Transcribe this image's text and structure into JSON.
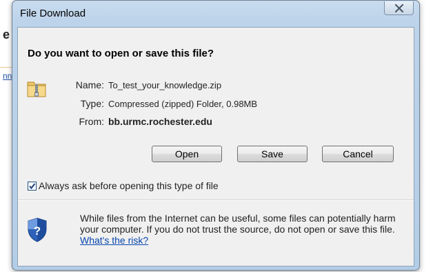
{
  "dialog": {
    "title": "File Download",
    "question": "Do you want to open or save this file?",
    "file": {
      "name_label": "Name:",
      "name_value": "To_test_your_knowledge.zip",
      "type_label": "Type:",
      "type_value": "Compressed (zipped) Folder, 0.98MB",
      "from_label": "From:",
      "from_value": "bb.urmc.rochester.edu"
    },
    "buttons": {
      "open": "Open",
      "save": "Save",
      "cancel": "Cancel"
    },
    "always_ask": {
      "label": "Always ask before opening this type of file",
      "checked": true
    },
    "warning": {
      "text": "While files from the Internet can be useful, some files can potentially harm your computer. If you do not trust the source, do not open or save this file.",
      "link": "What's the risk?"
    },
    "icons": {
      "file": "zip-folder-icon",
      "warning": "security-shield-icon",
      "close": "close-icon"
    }
  },
  "background": {
    "heading_fragment": "e",
    "link_fragment": "nn"
  }
}
